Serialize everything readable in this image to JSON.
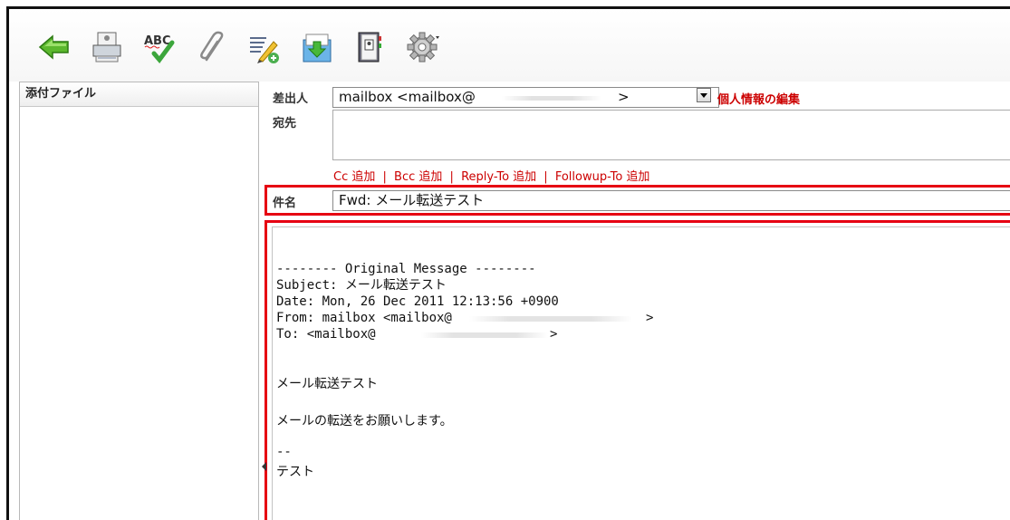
{
  "toolbar": {
    "buttons": [
      {
        "icon": "back-arrow-icon"
      },
      {
        "icon": "save-icon"
      },
      {
        "icon": "spellcheck-icon",
        "label": "ABC"
      },
      {
        "icon": "attach-icon"
      },
      {
        "icon": "signature-icon"
      },
      {
        "icon": "insert-response-icon"
      },
      {
        "icon": "address-book-icon"
      },
      {
        "icon": "gear-icon"
      }
    ]
  },
  "attachments": {
    "header": "添付ファイル"
  },
  "compose": {
    "from_label": "差出人",
    "from_value": "mailbox <mailbox@",
    "from_value_end": ">",
    "edit_identity": "個人情報の編集",
    "to_label": "宛先",
    "to_value": "",
    "add_links": [
      "Cc 追加",
      "Bcc 追加",
      "Reply-To 追加",
      "Followup-To 追加"
    ],
    "add_separator": "|",
    "subject_label": "件名",
    "subject_value": "Fwd: メール転送テスト",
    "body": {
      "original_header": "-------- Original Message --------",
      "subject_line": "Subject: メール転送テスト",
      "date_line": "Date: Mon, 26 Dec 2011 12:13:56 +0900",
      "from_line": "From: mailbox <mailbox@",
      "from_line_end": ">",
      "to_line": "To: <mailbox@",
      "to_line_end": ">",
      "text1": "メール転送テスト",
      "text2": "メールの転送をお願いします。",
      "sig_sep": "--",
      "sig_name": "テスト"
    }
  },
  "colors": {
    "highlight": "#e60012",
    "link": "#cc0000"
  }
}
